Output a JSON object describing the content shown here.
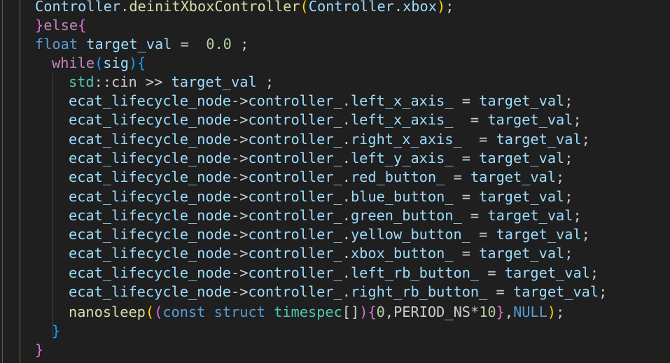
{
  "code": {
    "line1": {
      "obj": "Controller",
      "dot": ".",
      "fn": "deinitXboxController",
      "open": "(",
      "arg_obj": "Controller",
      "arg_dot": ".",
      "arg_member": "xbox",
      "close": ")",
      "semi": ";"
    },
    "line2": {
      "close_brace": "}",
      "kw": "else",
      "open_brace": "{"
    },
    "line3": {
      "type": "float",
      "var": "target_val",
      "assign": " =  ",
      "num": "0.0",
      "semi": " ;"
    },
    "line4": {
      "kw": "while",
      "open": "(",
      "arg": "sig",
      "close": ")",
      "brace": "{"
    },
    "line5": {
      "ns": "std",
      "sep": "::",
      "obj": "cin",
      "op": " >> ",
      "var": "target_val",
      "semi": " ;"
    },
    "assignments": [
      {
        "node": "ecat_lifecycle_node",
        "arrow": "->",
        "ctrl": "controller_",
        "dot": ".",
        "member": "left_x_axis_",
        "eq": " = ",
        "val": "target_val",
        "semi": ";"
      },
      {
        "node": "ecat_lifecycle_node",
        "arrow": "->",
        "ctrl": "controller_",
        "dot": ".",
        "member": "left_x_axis_",
        "eq": "  = ",
        "val": "target_val",
        "semi": ";"
      },
      {
        "node": "ecat_lifecycle_node",
        "arrow": "->",
        "ctrl": "controller_",
        "dot": ".",
        "member": "right_x_axis_",
        "eq": "  = ",
        "val": "target_val",
        "semi": ";"
      },
      {
        "node": "ecat_lifecycle_node",
        "arrow": "->",
        "ctrl": "controller_",
        "dot": ".",
        "member": "left_y_axis_",
        "eq": " = ",
        "val": "target_val",
        "semi": ";"
      },
      {
        "node": "ecat_lifecycle_node",
        "arrow": "->",
        "ctrl": "controller_",
        "dot": ".",
        "member": "red_button_",
        "eq": " = ",
        "val": "target_val",
        "semi": ";"
      },
      {
        "node": "ecat_lifecycle_node",
        "arrow": "->",
        "ctrl": "controller_",
        "dot": ".",
        "member": "blue_button_",
        "eq": " = ",
        "val": "target_val",
        "semi": ";"
      },
      {
        "node": "ecat_lifecycle_node",
        "arrow": "->",
        "ctrl": "controller_",
        "dot": ".",
        "member": "green_button_",
        "eq": " = ",
        "val": "target_val",
        "semi": ";"
      },
      {
        "node": "ecat_lifecycle_node",
        "arrow": "->",
        "ctrl": "controller_",
        "dot": ".",
        "member": "yellow_button_",
        "eq": " = ",
        "val": "target_val",
        "semi": ";"
      },
      {
        "node": "ecat_lifecycle_node",
        "arrow": "->",
        "ctrl": "controller_",
        "dot": ".",
        "member": "xbox_button_",
        "eq": " = ",
        "val": "target_val",
        "semi": ";"
      },
      {
        "node": "ecat_lifecycle_node",
        "arrow": "->",
        "ctrl": "controller_",
        "dot": ".",
        "member": "left_rb_button_",
        "eq": " = ",
        "val": "target_val",
        "semi": ";"
      },
      {
        "node": "ecat_lifecycle_node",
        "arrow": "->",
        "ctrl": "controller_",
        "dot": ".",
        "member": "right_rb_button_",
        "eq": " = ",
        "val": "target_val",
        "semi": ";"
      }
    ],
    "sleep": {
      "fn": "nanosleep",
      "open1": "(",
      "open2": "(",
      "kw_const": "const",
      "kw_struct": "struct",
      "type": "timespec",
      "brackets": "[]",
      "close2": ")",
      "brace_open": "{",
      "zero": "0",
      "comma1": ",",
      "period": "PERIOD_NS",
      "mul": "*",
      "ten": "10",
      "brace_close": "}",
      "comma2": ",",
      "null": "NULL",
      "close1": ")",
      "semi": ";"
    },
    "close_while": "}",
    "close_else": "}"
  }
}
